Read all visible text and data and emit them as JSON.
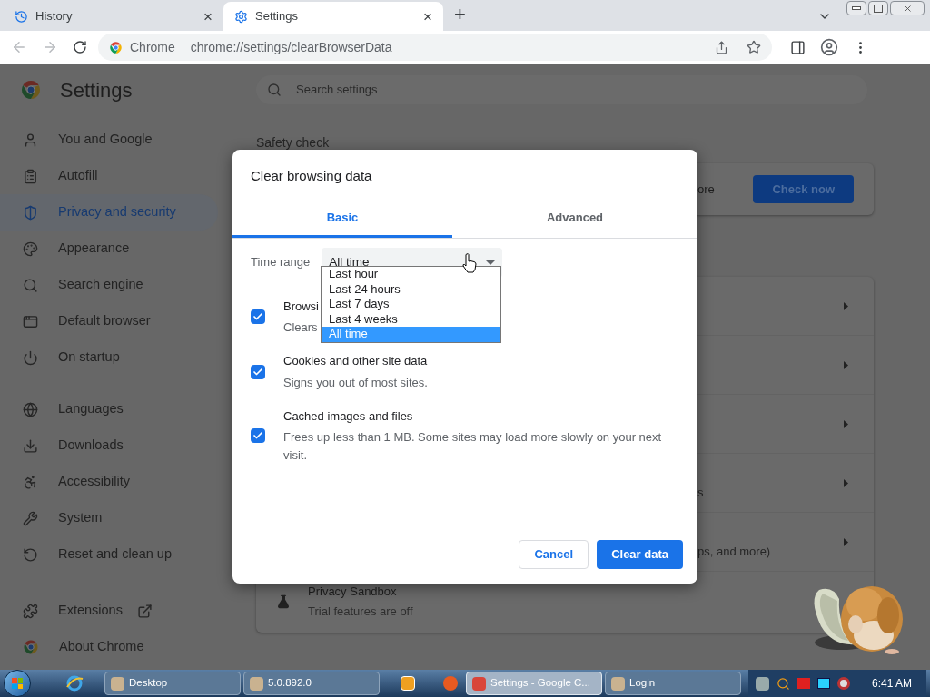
{
  "browser": {
    "tabs": [
      {
        "title": "History",
        "close": "×",
        "selected": false
      },
      {
        "title": "Settings",
        "close": "×",
        "selected": true
      }
    ],
    "new_tab": "+",
    "address": {
      "site_label": "Chrome",
      "url": "chrome://settings/clearBrowserData"
    }
  },
  "settings": {
    "title": "Settings",
    "search_placeholder": "Search settings",
    "sidebar_groups": [
      {
        "items": [
          {
            "label": "You and Google",
            "selected": false,
            "external": false
          },
          {
            "label": "Autofill",
            "selected": false,
            "external": false
          },
          {
            "label": "Privacy and security",
            "selected": true,
            "external": false
          },
          {
            "label": "Appearance",
            "selected": false,
            "external": false
          },
          {
            "label": "Search engine",
            "selected": false,
            "external": false
          },
          {
            "label": "Default browser",
            "selected": false,
            "external": false
          },
          {
            "label": "On startup",
            "selected": false,
            "external": false
          }
        ]
      },
      {
        "items": [
          {
            "label": "Languages",
            "selected": false,
            "external": false
          },
          {
            "label": "Downloads",
            "selected": false,
            "external": false
          },
          {
            "label": "Accessibility",
            "selected": false,
            "external": false
          },
          {
            "label": "System",
            "selected": false,
            "external": false
          },
          {
            "label": "Reset and clean up",
            "selected": false,
            "external": false
          }
        ]
      },
      {
        "items": [
          {
            "label": "Extensions",
            "selected": false,
            "external": true
          },
          {
            "label": "About Chrome",
            "selected": false,
            "external": false
          }
        ]
      }
    ],
    "safety_check": {
      "heading": "Safety check",
      "text": "ore",
      "button": "Check now"
    },
    "privacy_rows": [
      {
        "kind": "link"
      },
      {
        "kind": "link"
      },
      {
        "kind": "link"
      },
      {
        "kind": "link",
        "text": "s"
      },
      {
        "kind": "link",
        "text": "ps, and more)"
      }
    ],
    "privacy_sandbox": {
      "title": "Privacy Sandbox",
      "subtitle": "Trial features are off"
    }
  },
  "dialog": {
    "title": "Clear browsing data",
    "tabs": [
      {
        "label": "Basic",
        "selected": true
      },
      {
        "label": "Advanced",
        "selected": false
      }
    ],
    "time_range": {
      "label": "Time range",
      "value": "All time",
      "expanded": true,
      "options": [
        {
          "label": "Last hour",
          "selected": false
        },
        {
          "label": "Last 24 hours",
          "selected": false
        },
        {
          "label": "Last 7 days",
          "selected": false
        },
        {
          "label": "Last 4 weeks",
          "selected": false
        },
        {
          "label": "All time",
          "selected": true
        }
      ]
    },
    "items": [
      {
        "title": "Browsi",
        "subtitle": "Clears",
        "checked": true
      },
      {
        "title": "Cookies and other site data",
        "subtitle": "Signs you out of most sites.",
        "checked": true
      },
      {
        "title": "Cached images and files",
        "subtitle": "Frees up less than 1 MB. Some sites may load more slowly on your next visit.",
        "checked": true
      }
    ],
    "buttons": [
      {
        "label": "Cancel",
        "kind": "secondary"
      },
      {
        "label": "Clear data",
        "kind": "primary"
      }
    ]
  },
  "taskbar": {
    "buttons": [
      {
        "label": "Desktop",
        "selected": false
      },
      {
        "label": "5.0.892.0",
        "selected": false
      },
      {
        "label": "Settings - Google C...",
        "selected": true
      },
      {
        "label": "Login",
        "selected": false
      }
    ],
    "clock": "6:41 AM"
  }
}
